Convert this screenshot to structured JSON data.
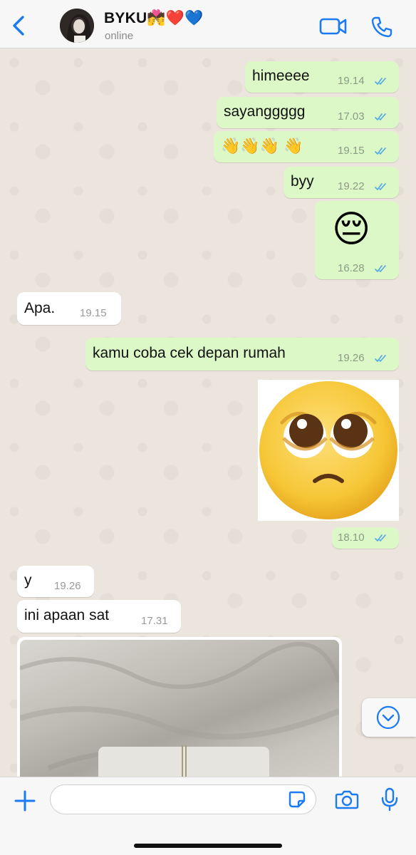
{
  "header": {
    "back_label": "",
    "contact_name": "BYKU💏❤️💙",
    "contact_status": "online"
  },
  "messages": [
    {
      "dir": "out",
      "text": "himeeee",
      "time": "19.14",
      "read": true
    },
    {
      "dir": "out",
      "text": "sayanggggg",
      "time": "17.03",
      "read": true
    },
    {
      "dir": "out",
      "text": "👋👋👋 👋",
      "time": "19.15",
      "read": true
    },
    {
      "dir": "out",
      "text": "byy",
      "time": "19.22",
      "read": true
    },
    {
      "dir": "out",
      "text": "😔",
      "time": "16.28",
      "read": true,
      "kind": "big-emoji"
    },
    {
      "dir": "in",
      "text": "Apa.",
      "time": "19.15"
    },
    {
      "dir": "out",
      "text": "kamu coba cek depan rumah",
      "time": "19.26",
      "read": true
    },
    {
      "dir": "out",
      "text": "",
      "time": "18.10",
      "read": true,
      "kind": "sticker",
      "sticker_icon": "pleading-face-icon"
    },
    {
      "dir": "in",
      "text": "y",
      "time": "19.26"
    },
    {
      "dir": "in",
      "text": "ini apaan sat",
      "time": "17.31"
    },
    {
      "dir": "in",
      "text": "",
      "time": "",
      "kind": "photo"
    }
  ],
  "composer": {
    "placeholder": ""
  },
  "icons": {
    "back": "chevron-left-icon",
    "video": "video-camera-icon",
    "call": "phone-icon",
    "plus": "plus-icon",
    "sticker": "sticker-icon",
    "camera": "camera-icon",
    "mic": "microphone-icon",
    "scroll": "chevron-down-circle-icon"
  },
  "colors": {
    "accent": "#1a7bf5",
    "outgoing_bubble": "#dcf8c6",
    "incoming_bubble": "#ffffff",
    "read_ticks": "#4fa7e8",
    "chat_background": "#ece5dd"
  }
}
